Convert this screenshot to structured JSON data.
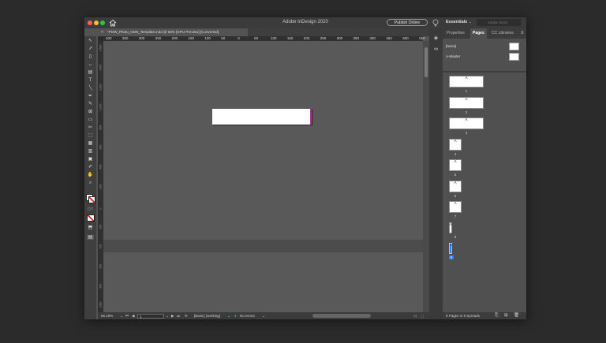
{
  "window": {
    "app_title": "Adobe InDesign 2020",
    "publish_label": "Publish Online",
    "workspace": "Essentials",
    "stock_placeholder": "Adobe Stock",
    "home_icon": "home-icon",
    "lightbulb_icon": "lightbulb-icon",
    "traffic_lights": [
      "#ff5f57",
      "#febc2e",
      "#28c840"
    ]
  },
  "document": {
    "tab_title": "*POW_Photo_GDN_Template.indd @ 66% [GPU Preview] [Converted]"
  },
  "tools": [
    {
      "name": "selection-tool-icon",
      "glyph": "↖"
    },
    {
      "name": "direct-selection-tool-icon",
      "glyph": "↗"
    },
    {
      "name": "page-tool-icon",
      "glyph": "▯"
    },
    {
      "name": "gap-tool-icon",
      "glyph": "↔"
    },
    {
      "name": "content-collector-icon",
      "glyph": "▤"
    },
    {
      "name": "type-tool-icon",
      "glyph": "T"
    },
    {
      "name": "line-tool-icon",
      "glyph": "╲"
    },
    {
      "name": "pen-tool-icon",
      "glyph": "✒"
    },
    {
      "name": "pencil-tool-icon",
      "glyph": "✎"
    },
    {
      "name": "rectangle-frame-tool-icon",
      "glyph": "⊠"
    },
    {
      "name": "rectangle-tool-icon",
      "glyph": "▭"
    },
    {
      "name": "scissors-tool-icon",
      "glyph": "✂"
    },
    {
      "name": "free-transform-tool-icon",
      "glyph": "⬚"
    },
    {
      "name": "gradient-swatch-tool-icon",
      "glyph": "▦"
    },
    {
      "name": "gradient-feather-tool-icon",
      "glyph": "▥"
    },
    {
      "name": "note-tool-icon",
      "glyph": "▣"
    },
    {
      "name": "eyedropper-tool-icon",
      "glyph": "✐"
    },
    {
      "name": "hand-tool-icon",
      "glyph": "✋"
    },
    {
      "name": "zoom-tool-icon",
      "glyph": "⌕"
    }
  ],
  "ruler": {
    "h_labels": [
      "400",
      "350",
      "300",
      "250",
      "200",
      "150",
      "100",
      "50",
      "0",
      "50",
      "100",
      "150",
      "200",
      "250",
      "300",
      "350",
      "400",
      "450",
      "500",
      "550"
    ],
    "v_labels": [
      "-1600",
      "-1400",
      "-1200",
      "-1000",
      "-800",
      "-600",
      "-400",
      "-200",
      "0",
      "200",
      "400",
      "600",
      "800",
      "1000"
    ]
  },
  "status": {
    "zoom": "66.16%",
    "page": "1",
    "style": "[Basic] (working)",
    "errors": "No errors"
  },
  "panel": {
    "tabs": [
      "Properties",
      "Pages",
      "CC Libraries"
    ],
    "active_tab": "Pages",
    "masters": [
      "[None]",
      "A-Master"
    ],
    "pages": [
      {
        "label": "1",
        "letter": "A"
      },
      {
        "label": "2",
        "letter": "A"
      },
      {
        "label": "3",
        "letter": "A"
      },
      {
        "label": "4",
        "letter": "A"
      },
      {
        "label": "5",
        "letter": "A"
      },
      {
        "label": "6",
        "letter": "A"
      },
      {
        "label": "7",
        "letter": "A"
      },
      {
        "label": "8",
        "letter": "A"
      },
      {
        "label": "9",
        "letter": "A"
      }
    ],
    "footer": "9 Pages in 9 Spreads",
    "accent_color": "#2d7ff9"
  }
}
